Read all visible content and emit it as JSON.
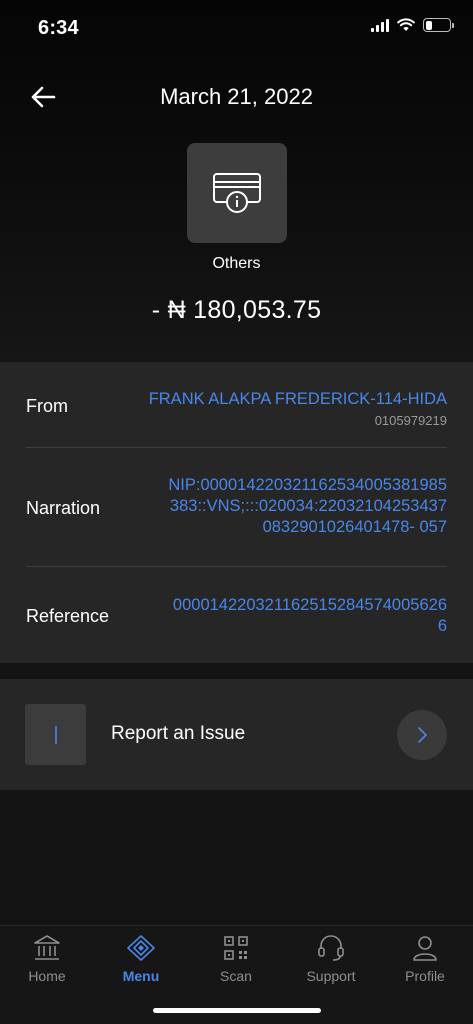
{
  "status_bar": {
    "time": "6:34"
  },
  "header": {
    "title": "March 21, 2022"
  },
  "transaction": {
    "category_icon": "card-info-icon",
    "category": "Others",
    "amount": "- ₦ 180,053.75"
  },
  "details": {
    "from": {
      "label": "From",
      "name": "FRANK ALAKPA FREDERICK-114-HIDA",
      "account": "0105979219"
    },
    "narration": {
      "label": "Narration",
      "lines": [
        "NIP:000014220321162534005381985",
        "383::VNS;:::020034:22032104253437",
        "0832901026401478- 057"
      ]
    },
    "reference": {
      "label": "Reference",
      "lines": [
        "000014220321162515284574005626",
        "6"
      ]
    }
  },
  "report": {
    "label": "Report an Issue"
  },
  "tabs": [
    {
      "label": "Home",
      "icon": "bank-icon"
    },
    {
      "label": "Menu",
      "icon": "menu-diamond-icon",
      "active": true
    },
    {
      "label": "Scan",
      "icon": "qr-code-icon"
    },
    {
      "label": "Support",
      "icon": "headset-icon"
    },
    {
      "label": "Profile",
      "icon": "user-icon"
    }
  ],
  "colors": {
    "accent": "#4a86e8",
    "background": "#141414",
    "card": "#262626"
  }
}
